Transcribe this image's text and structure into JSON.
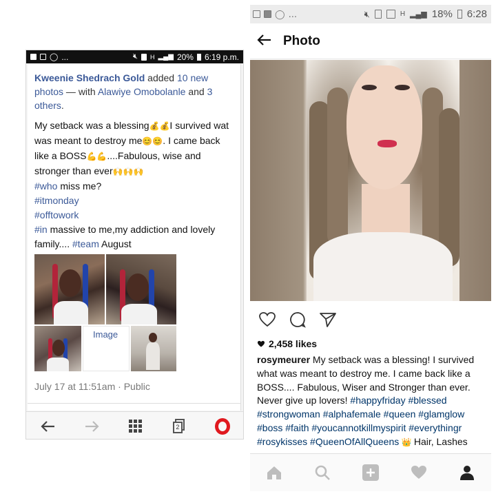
{
  "left": {
    "status": {
      "icons_left": [
        "facebook-icon",
        "image-icon",
        "whatsapp-icon",
        "more-icon"
      ],
      "more": "...",
      "network": "H",
      "battery": "20%",
      "time": "6:19 p.m."
    },
    "post": {
      "author": "Kweenie Shedrach Gold",
      "added": " added ",
      "photo_count": "10 new photos",
      "with": " — with ",
      "tagged": "Alawiye Omobolanle",
      "and": " and ",
      "others": "3 others",
      "period": ".",
      "lines": {
        "l1a": "My setback was a blessing",
        "l1b": "I survived wat",
        "l2a": "was meant to destroy me",
        "l2b": ". I came back",
        "l3a": "like a BOSS",
        "l3b": "....Fabulous, wise and",
        "l4a": "stronger than ever"
      },
      "emoji_money": "💰💰",
      "emoji_smile": "😊😊",
      "emoji_muscle": "💪💪",
      "emoji_praise": "🙌🙌🙌",
      "tag_who": "#who",
      "who_rest": " miss me?",
      "tag_itmonday": "#itmonday",
      "tag_offtowork": "#offtowork",
      "tag_in": "#in",
      "in_rest": " massive to me,my addiction and lovely",
      "family": "family....",
      "tag_team": "#team",
      "august": " August",
      "image_alt": "Image",
      "timestamp": "July 17 at 11:51am",
      "dot": " · ",
      "privacy": "Public"
    },
    "nav": {
      "tabs_count": "2"
    }
  },
  "right": {
    "status": {
      "icons_left": [
        "image-icon",
        "facebook-icon",
        "whatsapp-icon",
        "more-icon"
      ],
      "more": "...",
      "network": "H",
      "battery": "18%",
      "time": "6:28"
    },
    "header": {
      "title": "Photo"
    },
    "post": {
      "likes": "2,458 likes",
      "username": "rosymeurer",
      "caption": {
        "c1": " My setback was a blessing! I survived",
        "c2": "what was meant to destroy me. I came back like a",
        "c3": "BOSS.... Fabulous, Wiser and Stronger than ever.",
        "c4": "Never give up lovers! ",
        "h_happyfriday": "#happyfriday",
        "h_blessed": "#blessed",
        "h_strongwoman": "#strongwoman",
        "h_alphafemale": "#alphafemale",
        "h_queen": "#queen",
        "h_glamglow": "#glamglow",
        "h_boss": "#boss",
        "h_faith": "#faith",
        "h_youcannotkill": "#youcannotkillmyspirit",
        "h_everything": "#everythingr",
        "h_rosykisses": "#rosykisses",
        "h_queenofall": "#QueenOfAllQueens",
        "crown": " 👑 ",
        "hair": "Hair, Lashes"
      }
    },
    "colors": {
      "fb_link": "#3b5998",
      "ig_hashtag": "#003569",
      "lip": "#d0304f",
      "opera_red": "#e0191f"
    }
  }
}
